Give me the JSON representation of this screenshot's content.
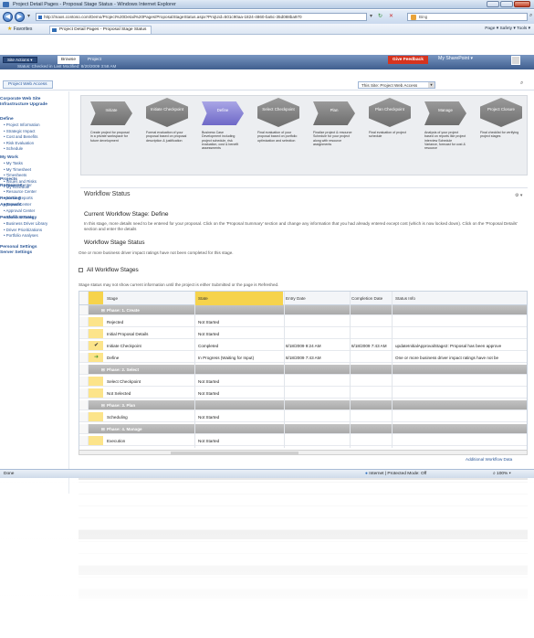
{
  "window": {
    "title": "Project Detail Pages - Proposal Stage Status - Windows Internet Explorer"
  },
  "browser": {
    "url": "http://maxs.contoso.com/Demo/Project%20Detail%20Pages/ProposalStageStatus.aspx?ProjUid=501c90aa-1824-4860-ba5c-35d088ba970",
    "search_placeholder": "Bing",
    "favorites_label": "Favorites",
    "tab_title": "Project Detail Pages - Proposal Stage Status",
    "tools": "Page ▾  Safety ▾  Tools ▾"
  },
  "sharepoint": {
    "site_actions": "Site Actions ▾",
    "browse_tab": "Browse",
    "project_tab": "Project",
    "status_label": "Status:",
    "status_value": "Checked in",
    "modified_label": "Last Modified:",
    "modified_value": "8/20/2009 3:58 AM",
    "feedback": "Give Feedback",
    "my_sharepoint": "My SharePoint ▾",
    "pwa_button": "Project Web Access",
    "scope": "This Site: Project Web Access"
  },
  "leftnav": {
    "sections": [
      {
        "title": "Corporate Web Site Infrastructure Upgrade",
        "items": []
      },
      {
        "title": "Define",
        "items": [
          "Project Information",
          "Strategic Impact",
          "Cost and Benefits",
          "Risk Evaluation",
          "Schedule"
        ]
      },
      {
        "title": "My Work",
        "items": [
          "My Tasks",
          "My Timesheet",
          "Timesheets",
          "Issues and Risks",
          "My Schedule"
        ]
      },
      {
        "title": "Projects",
        "items": [
          "Project Center"
        ]
      },
      {
        "title": "Resources",
        "items": [
          "Resource Center",
          "Status Reports"
        ]
      },
      {
        "title": "Reporting",
        "items": [
          "Report Center"
        ]
      },
      {
        "title": "Approvals",
        "items": [
          "Approval Center",
          "Workflow Tasks"
        ]
      },
      {
        "title": "Portfolio Strategy",
        "items": [
          "Business Driver Library",
          "Driver Prioritizations",
          "Portfolio Analyses"
        ]
      },
      {
        "title": "Personal Settings",
        "items": []
      },
      {
        "title": "Server Settings",
        "items": []
      }
    ]
  },
  "process": {
    "stages": [
      {
        "name": "Initiate",
        "kind": "stage",
        "desc": "Create project for proposal in a private workspace for future development"
      },
      {
        "name": "Initiate Checkpoint",
        "kind": "checkpoint",
        "desc": "Formal evaluation of your proposal based on proposal description & justification"
      },
      {
        "name": "Define",
        "kind": "stage",
        "active": true,
        "desc": "Business Case Development including project schedule, risk evaluation, cost & benefit assessments"
      },
      {
        "name": "Select Checkpoint",
        "kind": "checkpoint",
        "desc": "Final evaluation of your proposal based on portfolio optimization and selection"
      },
      {
        "name": "Plan",
        "kind": "stage",
        "desc": "Finalize project & resource Schedule for your project along with resource assignments"
      },
      {
        "name": "Plan Checkpoint",
        "kind": "checkpoint",
        "desc": "Final evaluation of project schedule"
      },
      {
        "name": "Manage",
        "kind": "stage",
        "desc": "Analysis of your project based on reports like project interview Schedule Variance, forecast for cost & resource"
      },
      {
        "name": "Project Closure",
        "kind": "checkpoint",
        "desc": "Final checklist for verifying project stages"
      }
    ]
  },
  "workflow": {
    "title": "Workflow Status",
    "current_stage_title": "Current Workflow Stage: Define",
    "current_stage_desc": "In this stage, more details need to be entered for your proposal. Click on the 'Proposal Summary' section and change any information that you had already entered except cost (which is now locked down). Click on the 'Proposal Details' section and enter the details",
    "stage_status_title": "Workflow Stage Status",
    "stage_status_desc": "One or more business driver impact ratings have not been completed for this stage.",
    "all_stages_title": "All Workflow Stages",
    "all_stages_note": "Stage status may not show current information until the project is either Submitted or the page is Refreshed.",
    "columns": [
      "Stage",
      "State",
      "Entry Date",
      "Completion Date",
      "Status Info"
    ],
    "rows": [
      {
        "type": "phase",
        "stage": "Phase: 1. Create"
      },
      {
        "type": "row",
        "mark": "",
        "stage": "Rejected",
        "state": "Not Started",
        "entry": "",
        "completion": "",
        "info": ""
      },
      {
        "type": "row",
        "mark": "",
        "stage": "Initial Proposal Details",
        "state": "Not Started",
        "entry": "",
        "completion": "",
        "info": ""
      },
      {
        "type": "row",
        "mark": "check",
        "stage": "Initiate Checkpoint",
        "state": "Completed",
        "entry": "8/18/2009 9:24 AM",
        "completion": "8/18/2009 7:43 AM",
        "info": "updateInitialApprovalStage2: Proposal has been approve"
      },
      {
        "type": "row",
        "mark": "arrow",
        "stage": "Define",
        "state": "In Progress (Waiting for Input)",
        "entry": "8/18/2009 7:43 AM",
        "completion": "",
        "info": "One or more business driver impact ratings have not be"
      },
      {
        "type": "phase",
        "stage": "Phase: 2. Select"
      },
      {
        "type": "row",
        "mark": "",
        "stage": "Select Checkpoint",
        "state": "Not Started",
        "entry": "",
        "completion": "",
        "info": ""
      },
      {
        "type": "row",
        "mark": "",
        "stage": "Not Selected",
        "state": "Not Started",
        "entry": "",
        "completion": "",
        "info": ""
      },
      {
        "type": "phase",
        "stage": "Phase: 3. Plan"
      },
      {
        "type": "row",
        "mark": "",
        "stage": "Scheduling",
        "state": "Not Started",
        "entry": "",
        "completion": "",
        "info": ""
      },
      {
        "type": "phase",
        "stage": "Phase: 4. Manage"
      },
      {
        "type": "row",
        "mark": "",
        "stage": "Execution",
        "state": "Not Started",
        "entry": "",
        "completion": "",
        "info": ""
      }
    ],
    "additional_link": "Additional Workflow Data"
  },
  "statusbar": {
    "done": "Done",
    "zone": "Internet | Protected Mode: Off",
    "zoom": "100%"
  }
}
